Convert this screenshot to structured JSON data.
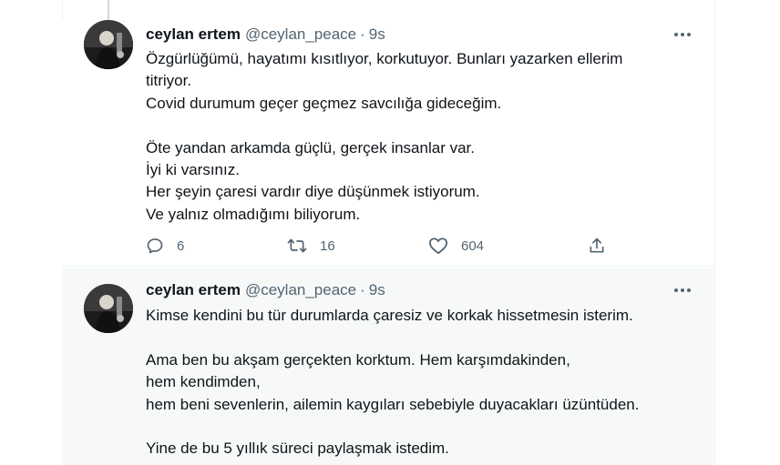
{
  "tweets": [
    {
      "author_name": "ceylan ertem",
      "handle": "@ceylan_peace",
      "separator": "·",
      "time": "9s",
      "lines": [
        "Özgürlüğümü, hayatımı kısıtlıyor, korkutuyor. Bunları yazarken ellerim",
        "titriyor.",
        "Covid durumum geçer geçmez savcılığa gideceğim.",
        "",
        "Öte yandan arkamda güçlü, gerçek insanlar var.",
        "İyi ki varsınız.",
        "Her şeyin çaresi vardır diye düşünmek istiyorum.",
        "Ve yalnız olmadığımı biliyorum."
      ],
      "replies": "6",
      "retweets": "16",
      "likes": "604"
    },
    {
      "author_name": "ceylan ertem",
      "handle": "@ceylan_peace",
      "separator": "·",
      "time": "9s",
      "lines": [
        "Kimse kendini bu tür durumlarda çaresiz ve korkak hissetmesin isterim.",
        "",
        "Ama ben bu akşam gerçekten korktum. Hem karşımdakinden,",
        "hem kendimden,",
        "hem beni sevenlerin, ailemin kaygıları sebebiyle duyacakları üzüntüden.",
        "",
        "Yine de bu 5 yıllık süreci paylaşmak istedim."
      ]
    }
  ],
  "icons": {
    "more": "more-horizontal-icon",
    "reply": "reply-icon",
    "retweet": "retweet-icon",
    "like": "heart-icon",
    "share": "share-icon"
  },
  "colors": {
    "text_primary": "#0f1419",
    "text_secondary": "#536471",
    "reply_background": "#f7f9f9",
    "divider": "#eff3f4"
  }
}
